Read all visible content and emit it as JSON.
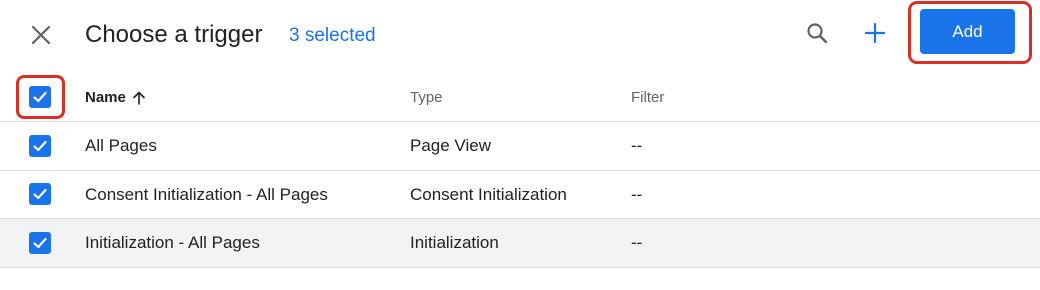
{
  "header": {
    "title": "Choose a trigger",
    "selected_text": "3 selected",
    "add_label": "Add",
    "close_icon": "close-icon",
    "search_icon": "search-icon",
    "plus_icon": "plus-icon"
  },
  "table": {
    "columns": {
      "name": "Name",
      "type": "Type",
      "filter": "Filter"
    },
    "sort_icon": "arrow-up-icon",
    "select_all_checked": true,
    "rows": [
      {
        "name": "All Pages",
        "type": "Page View",
        "filter": "--",
        "checked": true
      },
      {
        "name": "Consent Initialization - All Pages",
        "type": "Consent Initialization",
        "filter": "--",
        "checked": true
      },
      {
        "name": "Initialization - All Pages",
        "type": "Initialization",
        "filter": "--",
        "checked": true
      }
    ]
  },
  "colors": {
    "accent": "#1a73e8",
    "highlight_outline": "#d93025",
    "row_hover": "#f1f3f4"
  }
}
